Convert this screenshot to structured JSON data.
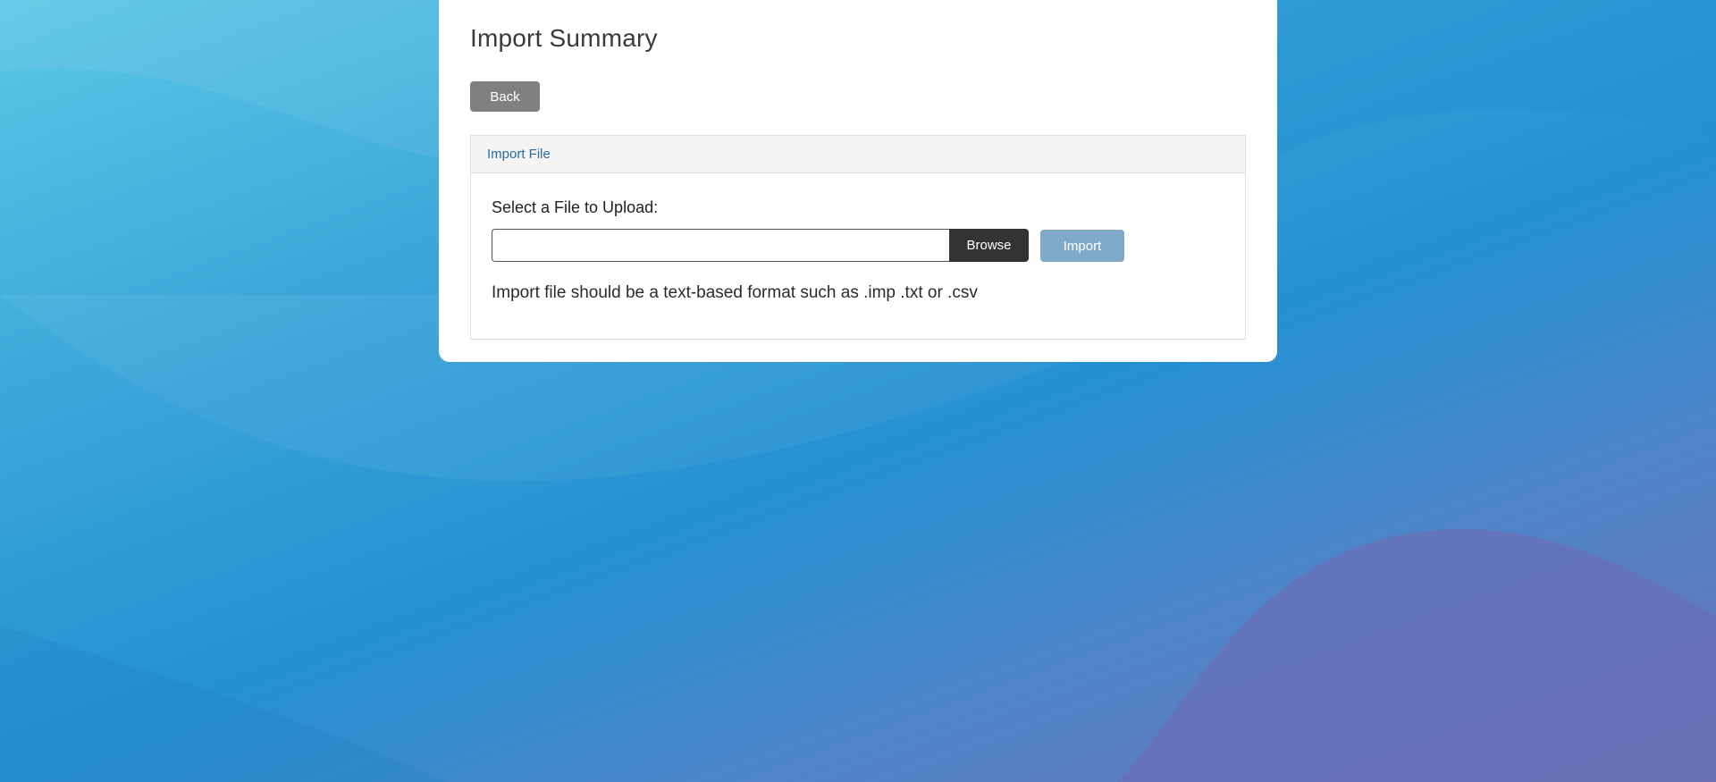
{
  "page": {
    "title": "Import Summary",
    "back_label": "Back"
  },
  "panel": {
    "header": "Import File",
    "file_label": "Select a File to Upload:",
    "file_value": "",
    "browse_label": "Browse",
    "import_label": "Import",
    "hint": "Import file should be a text-based format such as .imp .txt or .csv"
  },
  "colors": {
    "back_button": "#808080",
    "browse_button": "#333333",
    "import_button_disabled": "#7ea9c8",
    "panel_header_text": "#2a6b9c",
    "background_light": "#5cc8e6",
    "background_mid": "#2490d2",
    "background_purple": "#6b72b6"
  }
}
